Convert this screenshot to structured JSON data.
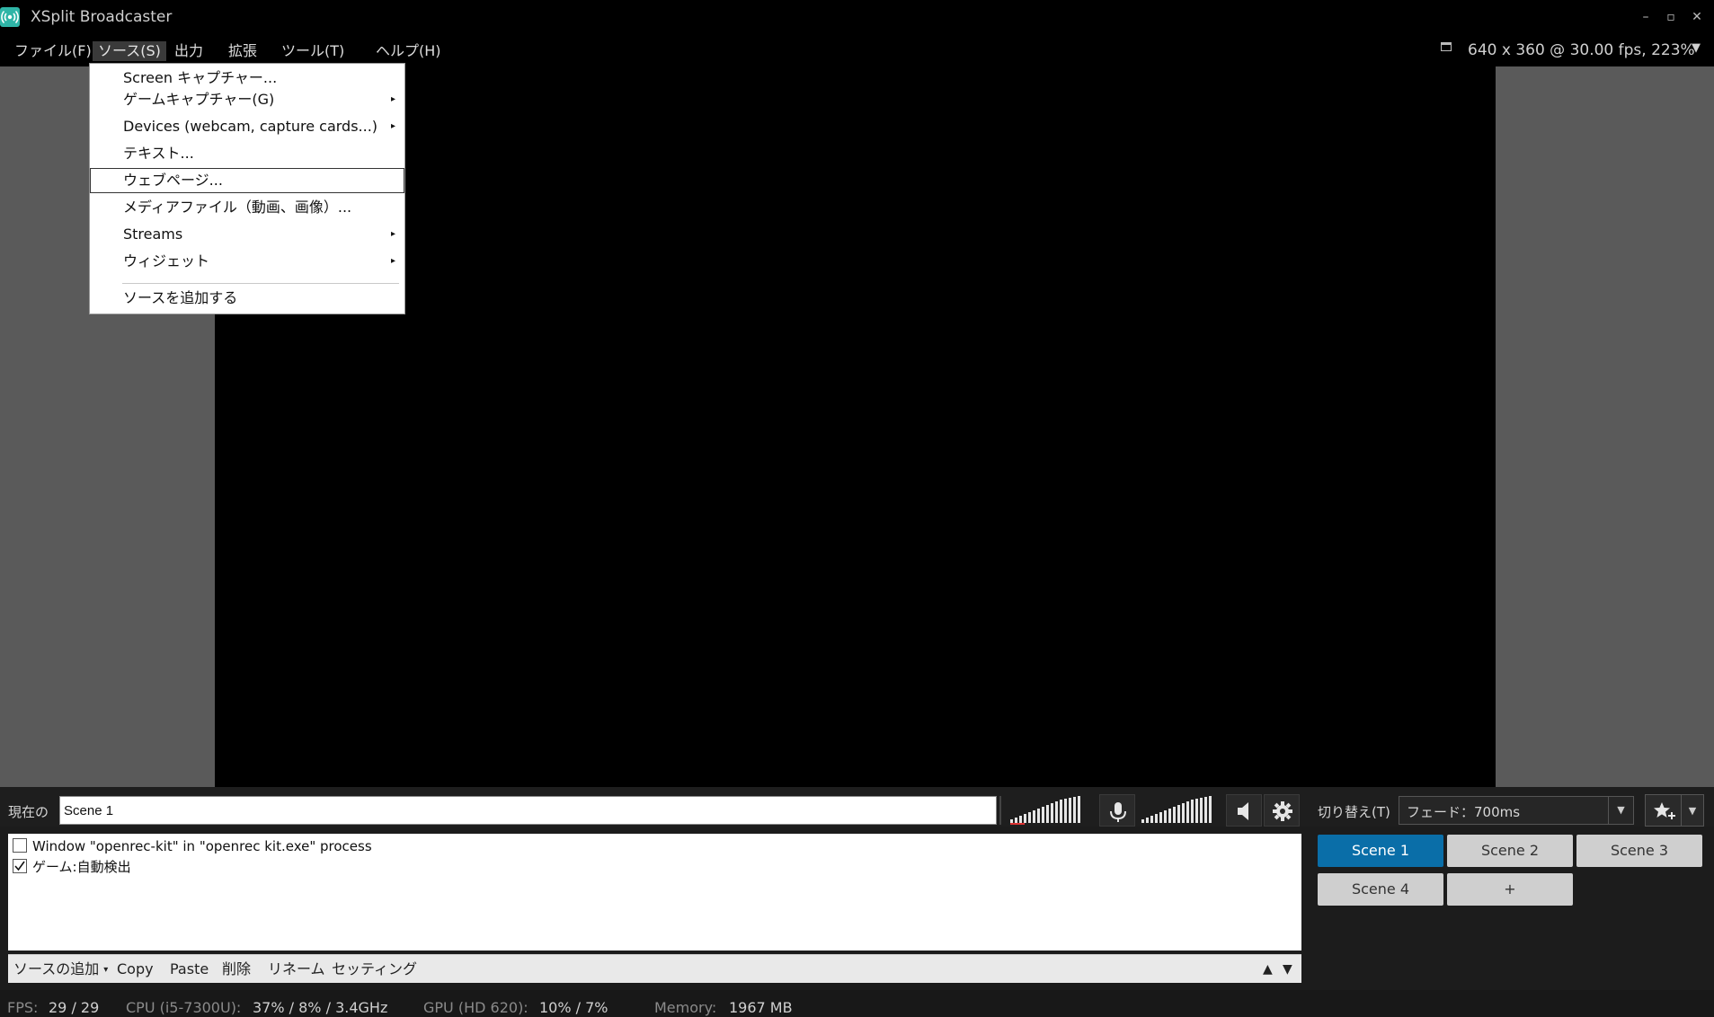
{
  "window": {
    "title": "XSplit Broadcaster",
    "controls": {
      "minimize": "–",
      "maximize": "▫",
      "close": "✕"
    }
  },
  "menubar": {
    "items": [
      "ファイル(F)",
      "ソース(S)",
      "出力",
      "拡張",
      "ツール(T)",
      "ヘルプ(H)"
    ],
    "active": "ソース(S)"
  },
  "resolution_status": "640 x 360 @ 30.00 fps, 223%",
  "source_menu": {
    "items": [
      {
        "label": "Screen キャプチャー...",
        "submenu": false
      },
      {
        "label": "ゲームキャプチャー(G)",
        "submenu": true
      },
      {
        "label": "Devices (webcam, capture cards...)",
        "submenu": true
      },
      {
        "label": "テキスト...",
        "submenu": false
      },
      {
        "label": "ウェブページ...",
        "submenu": false,
        "highlighted": true
      },
      {
        "label": "メディアファイル（動画、画像）...",
        "submenu": false
      },
      {
        "label": "Streams",
        "submenu": true
      },
      {
        "label": "ウィジェット",
        "submenu": true
      },
      {
        "label": "ソースを追加する",
        "submenu": false
      }
    ]
  },
  "scene_bar": {
    "current_label": "現在の",
    "scene_name": "Scene 1",
    "icons": [
      "microphone-icon",
      "speaker-icon",
      "gear-icon"
    ]
  },
  "transition": {
    "label": "切り替え(T)",
    "value": "フェード：700ms"
  },
  "sources": [
    {
      "label": "Window \"openrec-kit\" in \"openrec kit.exe\" process",
      "checked": false
    },
    {
      "label": "ゲーム:自動検出",
      "checked": true
    }
  ],
  "source_toolbar": {
    "add": "ソースの追加",
    "copy": "Copy",
    "paste": "Paste",
    "delete": "削除",
    "rename": "リネーム",
    "settings": "セッティング",
    "up": "▲",
    "down": "▼"
  },
  "scenes": [
    "Scene 1",
    "Scene 2",
    "Scene 3",
    "Scene 4",
    "+"
  ],
  "active_scene": "Scene 1",
  "status": {
    "fps_label": "FPS:",
    "fps": "29 / 29",
    "cpu_label": "CPU (i5-7300U):",
    "cpu": "37% / 8% / 3.4GHz",
    "gpu_label": "GPU (HD 620):",
    "gpu": "10% / 7%",
    "mem_label": "Memory:",
    "mem": "1967 MB"
  },
  "colors": {
    "active_scene": "#0a6ea8",
    "preview": "#000000",
    "workspace": "#5a5a5a",
    "app_logo": "#2fb5a7"
  }
}
